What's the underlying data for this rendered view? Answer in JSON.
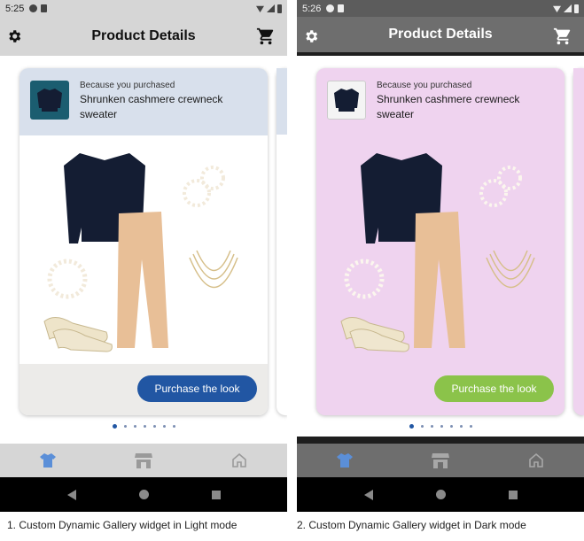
{
  "panels": [
    {
      "mode": "light",
      "status_time": "5:25",
      "title": "Product Details",
      "eyebrow": "Because you purchased",
      "product_name": "Shrunken cashmere crewneck sweater",
      "cta_label": "Purchase the look",
      "caption": "1. Custom Dynamic Gallery widget in Light mode",
      "colors": {
        "bar": "#d6d6d6",
        "card": "#ffffff",
        "header": "#d8e0ec",
        "cta": "#2156a3",
        "nav_active": "#5b8fd8",
        "nav_inactive": "#9a9a9a"
      }
    },
    {
      "mode": "dark",
      "status_time": "5:26",
      "title": "Product Details",
      "eyebrow": "Because you purchased",
      "product_name": "Shrunken cashmere crewneck sweater",
      "cta_label": "Purchase the look",
      "caption": "2. Custom Dynamic Gallery widget in Dark mode",
      "colors": {
        "bar": "#6e6e6e",
        "card": "#efd3ef",
        "header": "#efd3ef",
        "cta": "#8bc34a",
        "nav_active": "#5b8fd8",
        "nav_inactive": "#a8a8a8"
      }
    }
  ],
  "carousel": {
    "page_count": 7,
    "active_index": 0
  },
  "icons": {
    "settings": "gear-icon",
    "cart": "shopping-cart-icon",
    "tab1": "tshirt-icon",
    "tab2": "storefront-icon",
    "tab3": "home-icon",
    "sys_back": "back-triangle-icon",
    "sys_home": "home-circle-icon",
    "sys_recent": "recents-square-icon"
  }
}
